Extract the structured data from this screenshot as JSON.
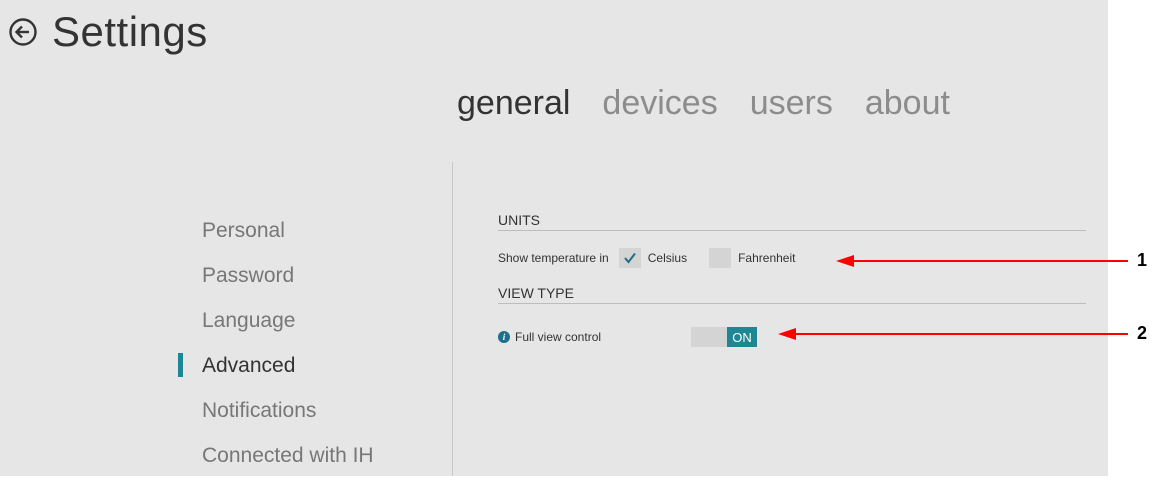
{
  "header": {
    "title": "Settings",
    "back_icon": "back-arrow-circle-icon"
  },
  "tabs": [
    {
      "label": "general",
      "active": true
    },
    {
      "label": "devices",
      "active": false
    },
    {
      "label": "users",
      "active": false
    },
    {
      "label": "about",
      "active": false
    }
  ],
  "sidebar": {
    "items": [
      {
        "label": "Personal"
      },
      {
        "label": "Password"
      },
      {
        "label": "Language"
      },
      {
        "label": "Advanced",
        "active": true
      },
      {
        "label": "Notifications"
      },
      {
        "label": "Connected with IH"
      }
    ]
  },
  "units": {
    "title": "UNITS",
    "row_label": "Show temperature in",
    "celsius_label": "Celsius",
    "celsius_checked": true,
    "fahrenheit_label": "Fahrenheit",
    "fahrenheit_checked": false
  },
  "view_type": {
    "title": "VIEW TYPE",
    "full_view_label": "Full view control",
    "toggle_state": "ON"
  },
  "annotations": {
    "callout_1": "1",
    "callout_2": "2"
  },
  "colors": {
    "accent": "#1e8794",
    "panel": "#e6e6e6",
    "annotation_arrow": "#ff0000"
  }
}
